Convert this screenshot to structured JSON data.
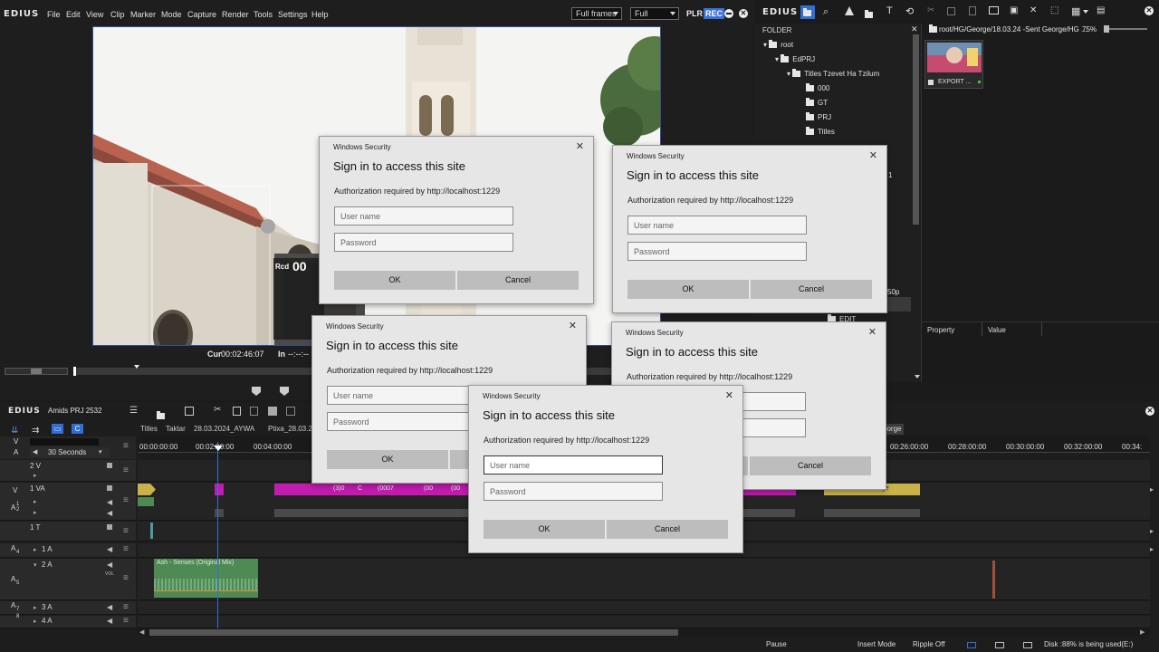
{
  "player": {
    "logo": "EDIUS",
    "menu": [
      "File",
      "Edit",
      "View",
      "Clip",
      "Marker",
      "Mode",
      "Capture",
      "Render",
      "Tools",
      "Settings",
      "Help"
    ],
    "frames_select": "Full frames",
    "quality_select": "Full",
    "plr_label": "PLR",
    "rec_label": "REC",
    "rcd_label": "Rcd",
    "rcd_value": "00",
    "cur_label": "Cur",
    "cur_value": "00:02:46:07",
    "in_label": "In",
    "in_value": "--:--:--"
  },
  "bin": {
    "logo": "EDIUS",
    "folder_header": "FOLDER",
    "path": "root/HG/George/18.03.24 -Sent George/HG ...",
    "zoom": "75%",
    "tree": [
      "root",
      "EdPRJ",
      "Titles  Tzevet Ha Tzilum",
      "000",
      "GT",
      "PRJ",
      "Titles",
      "EDIT"
    ],
    "clip_label": "EXPORT ...",
    "property_header": "Property",
    "value_header": "Value",
    "partial_a": "1",
    "partial_b": "50p"
  },
  "timeline": {
    "logo": "EDIUS",
    "project_name": "Amids PRJ 2532",
    "duration_select": "30 Seconds",
    "tabs": [
      "Titles",
      "Taktar",
      "28.03.2024_AYWA",
      "Ptixa_28.03.2",
      "eorge"
    ],
    "ruler": [
      "00:00:00:00",
      "00:02:00:00",
      "00:04:00:00",
      "00:26:00:00",
      "00:28:00:00",
      "00:30:00:00",
      "00:32:00:00",
      "00:34:"
    ],
    "tracks": {
      "v": "V",
      "a": "A",
      "v2": "2 V",
      "va1": "1 VA",
      "t1": "1 T",
      "a1": "1 A",
      "a2": "2 A",
      "a3": "3 A",
      "a4": "4 A",
      "side_v": "V",
      "side_a": "A",
      "side_a1": "1",
      "side_a2": "2",
      "side_a4": "A",
      "side_a4n": "4",
      "side_a5": "A",
      "side_a5n": "5",
      "side_a7": "A",
      "side_a7n": "7",
      "side_a8n": "8",
      "vol": "VOL"
    },
    "audio_clip": "Ash - Senses (Original Mix)",
    "clip_nums": [
      "(3)0",
      "C",
      "(0007",
      "(00",
      "(00"
    ],
    "clip_yellow": "...Footage",
    "status": {
      "pause": "Pause",
      "insert_mode": "Insert Mode",
      "ripple": "Ripple Off",
      "disk": "Disk :88% is being used(E:)"
    }
  },
  "dialog": {
    "app": "Windows Security",
    "close": "✕",
    "title": "Sign in to access this site",
    "message": "Authorization required by http://localhost:1229",
    "username_placeholder": "User name",
    "password_placeholder": "Password",
    "ok": "OK",
    "cancel": "Cancel"
  },
  "colors": {
    "accent_blue": "#2f6fd6",
    "clip_magenta": "#c21bb0",
    "clip_yellow": "#c9b349",
    "audio_green": "#4f8a55",
    "rec_blue": "#3a70d8"
  }
}
